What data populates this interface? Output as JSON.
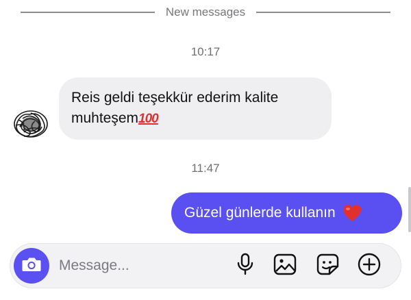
{
  "divider": {
    "label": "New messages"
  },
  "thread": {
    "timestamp_1": "10:17",
    "incoming": {
      "line1": "Reis geldi teşekkür ederim kalite",
      "line2": "muhteşem",
      "emoji": "💯"
    },
    "timestamp_2": "11:47",
    "outgoing": {
      "text": "Güzel günlerde kullanın",
      "emoji": "❤️"
    }
  },
  "composer": {
    "placeholder": "Message...",
    "icons": [
      "camera-icon",
      "microphone-icon",
      "image-icon",
      "sticker-icon",
      "add-icon"
    ]
  },
  "colors": {
    "accent": "#5a4ff0",
    "incoming_bubble": "#efeff2",
    "heart": "#e0312f"
  }
}
